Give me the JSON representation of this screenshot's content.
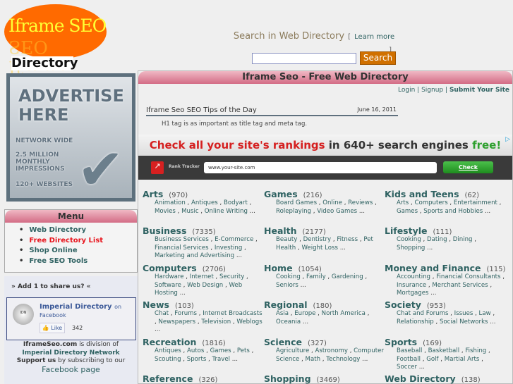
{
  "logo": {
    "title": "Iframe SEO",
    "subtitle": "Directory"
  },
  "search": {
    "label": "Search in Web Directory",
    "learn_more": "Learn more",
    "open_bracket": "[",
    "close_bracket": "]",
    "button": "Search",
    "value": ""
  },
  "advert": {
    "heading1": "ADVERTISE",
    "heading2": "HERE",
    "line1": "NETWORK WIDE",
    "line2": "2.5 MILLION",
    "line3": "MONTHLY",
    "line4": "IMPRESSIONS",
    "line5": "120+ WEBSITES"
  },
  "menu": {
    "title": "Menu",
    "items": [
      {
        "label": "Web Directory"
      },
      {
        "label": "Free Directory List"
      },
      {
        "label": "Shop Online"
      },
      {
        "label": "Free SEO Tools"
      }
    ]
  },
  "share": {
    "title": "» Add 1 to share us? «",
    "fb_name": "Imperial Directory",
    "fb_on": "on",
    "fb_facebook": "Facebook",
    "fb_avatar": "Imperial Directory Network",
    "like": "Like",
    "like_count": "342",
    "info1_b": "IframeSeo.com",
    "info1": " is division of",
    "info2": "Imperial Directory Network",
    "info3_b": "Support us",
    "info3": " by subscribing to our",
    "info4": "Facebook page"
  },
  "main": {
    "title": "Iframe Seo - Free Web Directory",
    "login": "Login",
    "signup": "Signup",
    "submit": "Submit Your Site",
    "sep": "|",
    "tip_title": "Iframe Seo SEO Tips of the Day",
    "tip_date": "June 16, 2011",
    "tip_text": "H1 tag is as important as title tag and meta tag."
  },
  "ad": {
    "red": "Check all your site's rankings",
    "mid": " in 640+ search engines ",
    "green": "free!",
    "brand": "Rank Tracker",
    "input": "www.your-site.com",
    "button": "Check"
  },
  "categories": [
    {
      "name": "Arts",
      "count": "(970)",
      "subs": [
        "Animation",
        "Antiques",
        "Bodyart",
        "Movies",
        "Music",
        "Online Writing"
      ]
    },
    {
      "name": "Games",
      "count": "(216)",
      "subs": [
        "Board Games",
        "Online",
        "Reviews",
        "Roleplaying",
        "Video Games"
      ]
    },
    {
      "name": "Kids and Teens",
      "count": "(62)",
      "subs": [
        "Arts",
        "Computers",
        "Entertainment",
        "Games",
        "Sports and Hobbies"
      ]
    },
    {
      "name": "Business",
      "count": "(7335)",
      "subs": [
        "Business Services",
        "E-Commerce",
        "Financial Services",
        "Investing",
        "Marketing and Advertising"
      ]
    },
    {
      "name": "Health",
      "count": "(2177)",
      "subs": [
        "Beauty",
        "Dentistry",
        "Fitness",
        "Pet Health",
        "Weight Loss"
      ]
    },
    {
      "name": "Lifestyle",
      "count": "(111)",
      "subs": [
        "Cooking",
        "Dating",
        "Dining",
        "Shopping"
      ]
    },
    {
      "name": "Computers",
      "count": "(2706)",
      "subs": [
        "Hardware",
        "Internet",
        "Security",
        "Software",
        "Web Design",
        "Web Hosting"
      ]
    },
    {
      "name": "Home",
      "count": "(1054)",
      "subs": [
        "Cooking",
        "Family",
        "Gardening",
        "Seniors"
      ]
    },
    {
      "name": "Money and Finance",
      "count": "(115)",
      "subs": [
        "Accounting",
        "Financial Consultants",
        "Insurance",
        "Merchant Services",
        "Mortgages"
      ]
    },
    {
      "name": "News",
      "count": "(103)",
      "subs": [
        "Chat",
        "Forums",
        "Internet Broadcasts",
        "Newspapers",
        "Television",
        "Weblogs"
      ]
    },
    {
      "name": "Regional",
      "count": "(180)",
      "subs": [
        "Asia",
        "Europe",
        "North America",
        "Oceania"
      ]
    },
    {
      "name": "Society",
      "count": "(953)",
      "subs": [
        "Chat and Forums",
        "Issues",
        "Law",
        "Relationship",
        "Social Networks"
      ]
    },
    {
      "name": "Recreation",
      "count": "(1816)",
      "subs": [
        "Antiques",
        "Autos",
        "Games",
        "Pets",
        "Scouting",
        "Sports",
        "Travel"
      ]
    },
    {
      "name": "Science",
      "count": "(327)",
      "subs": [
        "Agriculture",
        "Astronomy",
        "Computer Science",
        "Math",
        "Technology"
      ]
    },
    {
      "name": "Sports",
      "count": "(169)",
      "subs": [
        "Baseball",
        "Basketball",
        "Fishing",
        "Football",
        "Golf",
        "Martial Arts",
        "Soccer"
      ]
    },
    {
      "name": "Reference",
      "count": "(326)",
      "subs": []
    },
    {
      "name": "Shopping",
      "count": "(3469)",
      "subs": []
    },
    {
      "name": "Web Directory",
      "count": "(138)",
      "subs": []
    }
  ],
  "ellipsis": "..."
}
